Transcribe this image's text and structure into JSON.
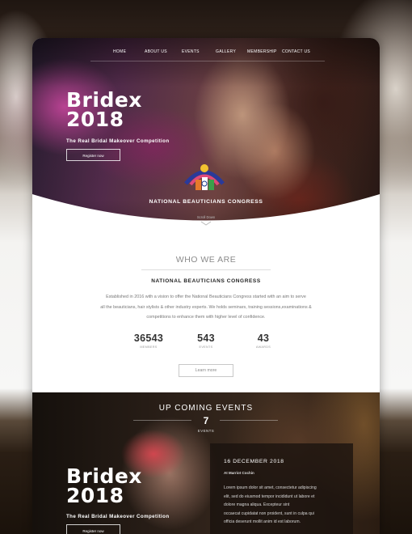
{
  "nav": {
    "items": [
      {
        "label": "HOME"
      },
      {
        "label": "ABOUT US"
      },
      {
        "label": "EVENTS"
      },
      {
        "label": "GALLERY"
      },
      {
        "label": "MEMBERSHIP"
      },
      {
        "label": "CONTACT US"
      }
    ]
  },
  "hero": {
    "brand_line1": "Bridex",
    "brand_line2": "2018",
    "tagline": "The Real Bridal Makeover Competition",
    "register_label": "Register now",
    "org_name": "NATIONAL BEAUTICIANS CONGRESS",
    "scroll_label": "Scroll Down"
  },
  "about": {
    "heading": "WHO WE ARE",
    "subheading": "NATIONAL BEAUTICIANS CONGRESS",
    "paragraph_lines": [
      "Established in 2016 with a vision to offer the National Beauticians Congress started with an aim to serve",
      "all the beauticians, hair stylists & other industry experts.  We holds seminars, training sessions,examinations &",
      "competitions to enhance them with higher level of confidence."
    ],
    "stats": [
      {
        "value": "36543",
        "label": "MEMBERS"
      },
      {
        "value": "543",
        "label": "EVENTS"
      },
      {
        "value": "43",
        "label": "AWARDS"
      }
    ],
    "learn_more_label": "Learn more"
  },
  "events": {
    "heading": "UP COMING EVENTS",
    "count": "7",
    "count_label": "EVENTS",
    "brand_line1": "Bridex",
    "brand_line2": "2018",
    "tagline": "The Real Bridal Makeover Competition",
    "register_label": "Register now",
    "card": {
      "date": "16 DECEMBER 2018",
      "venue": "At Marriot Cochin",
      "text_lines": [
        "Lorem ipsum dolor sit amet, consectetur adipiscing",
        "elit, sed do eiusmod tempor incididunt ut labore et",
        "dolore magna aliqua. Excepteur sint",
        "occaecat cupidatat non proident, sunt in culpa qui",
        "officia deserunt mollit anim id est laborum."
      ]
    }
  }
}
